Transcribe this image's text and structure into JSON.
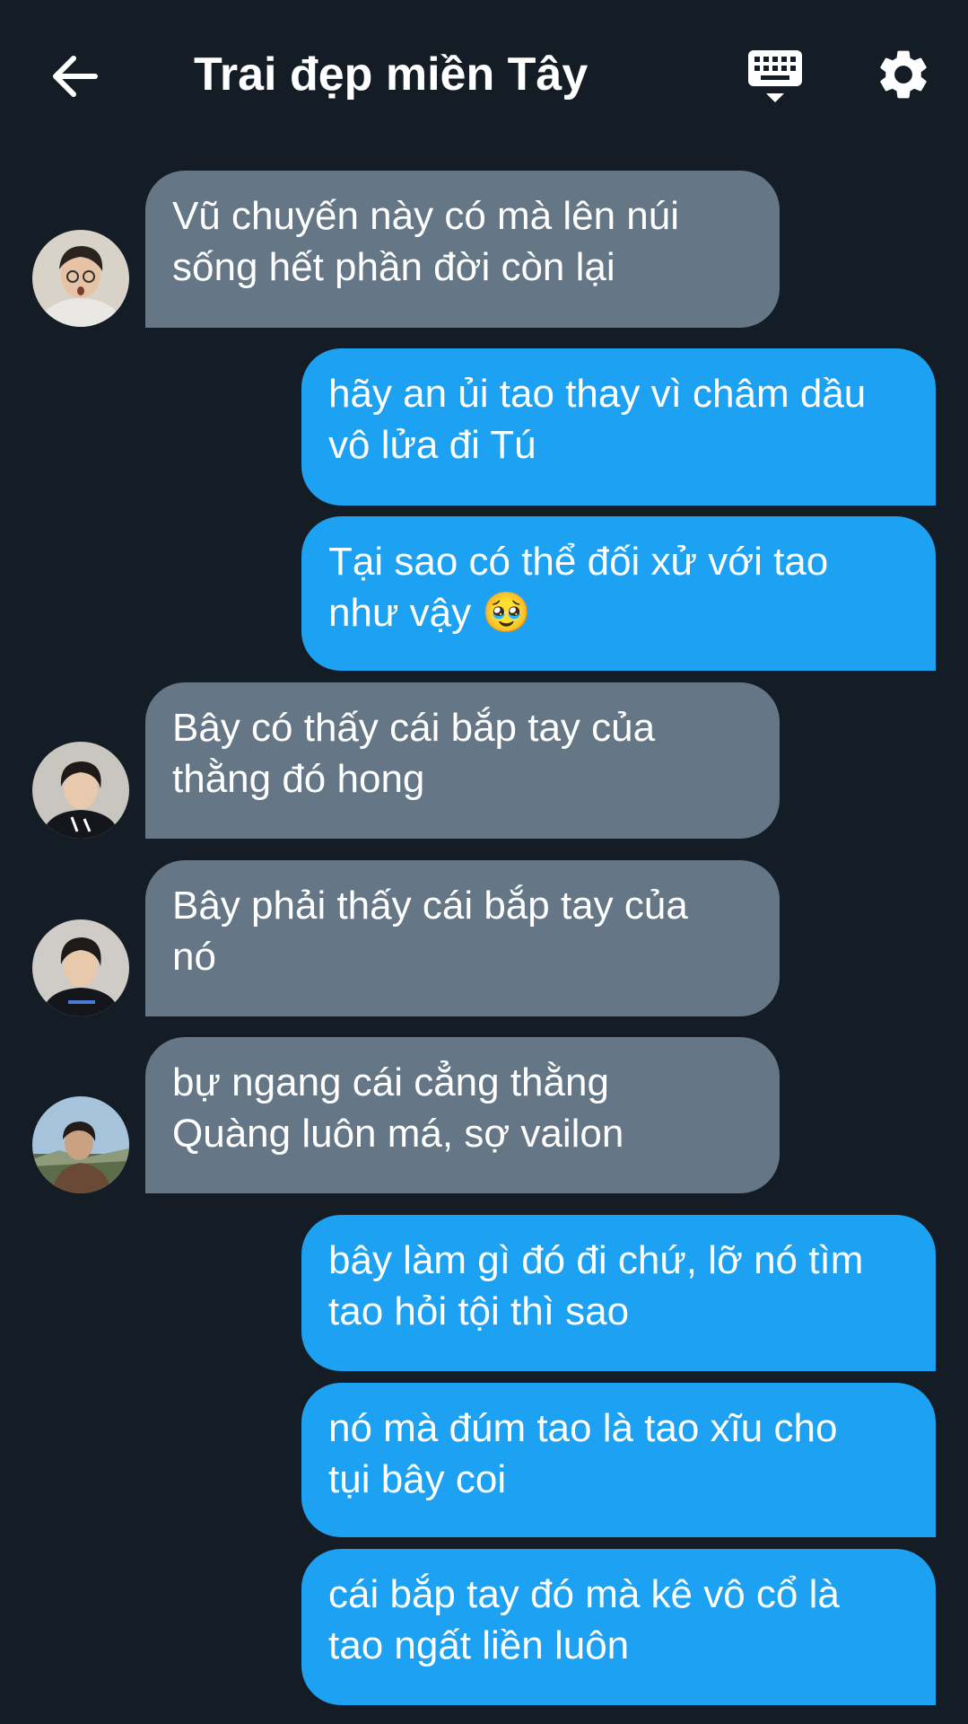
{
  "header": {
    "title": "Trai đẹp miền Tây",
    "back_icon": "arrow-left-icon",
    "keyboard_icon": "keyboard-icon",
    "settings_icon": "gear-icon"
  },
  "messages": [
    {
      "direction": "in",
      "text": "Vũ chuyến này có mà lên núi\nsống hết phần đời còn lại"
    },
    {
      "direction": "out",
      "text": "hãy an ủi tao thay vì châm dầu\nvô lửa đi Tú"
    },
    {
      "direction": "out",
      "text": "Tại sao có thể đối xử với tao\nnhư vậy 🥹"
    },
    {
      "direction": "in",
      "text": "Bây có thấy cái bắp tay của\nthằng đó hong"
    },
    {
      "direction": "in",
      "text": "Bây phải thấy cái bắp tay của\nnó"
    },
    {
      "direction": "in",
      "text": "bự ngang cái cẳng thằng\nQuàng luôn má, sợ vailon"
    },
    {
      "direction": "out",
      "text": "bây làm gì đó đi chứ, lỡ nó tìm\ntao hỏi tội thì sao"
    },
    {
      "direction": "out",
      "text": "nó mà đúm tao là tao xĩu cho\ntụi bây coi"
    },
    {
      "direction": "out",
      "text": "cái bắp tay đó mà kê vô cổ là\ntao ngất liền luôn"
    }
  ],
  "colors": {
    "background": "#141d26",
    "incoming_bubble": "#657786",
    "outgoing_bubble": "#1da1f2",
    "text": "#ffffff"
  }
}
